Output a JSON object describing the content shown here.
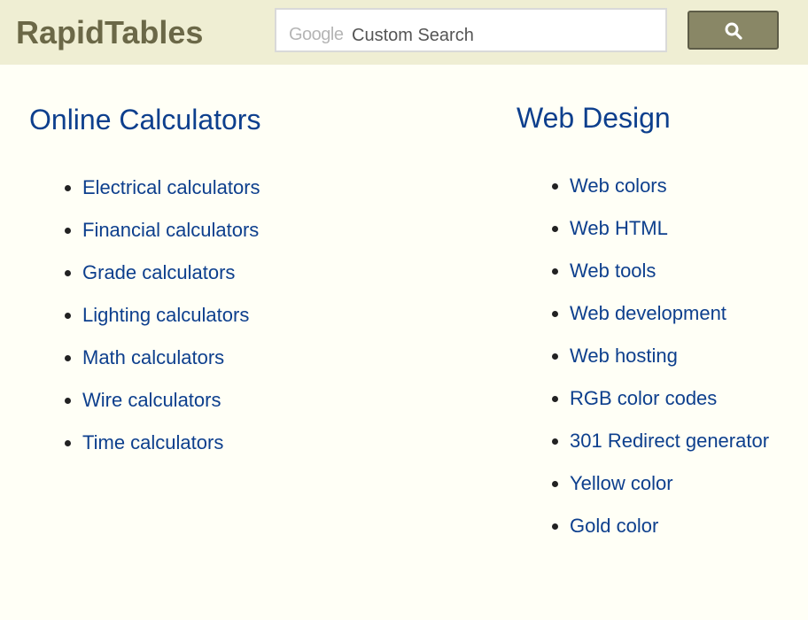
{
  "header": {
    "logo": "RapidTables",
    "search": {
      "brand": "Google",
      "placeholder": "Custom Search"
    },
    "search_button_icon": "search-icon"
  },
  "sections": [
    {
      "title": "Online Calculators",
      "items": [
        "Electrical calculators",
        "Financial calculators",
        "Grade calculators",
        "Lighting calculators",
        "Math calculators",
        "Wire calculators",
        "Time calculators"
      ]
    },
    {
      "title": "Web Design",
      "items": [
        "Web colors",
        "Web HTML",
        "Web tools",
        "Web development",
        "Web hosting",
        "RGB color codes",
        "301 Redirect generator",
        "Yellow color",
        "Gold color"
      ]
    }
  ],
  "colors": {
    "header_bg": "#efeed3",
    "logo": "#6b6847",
    "link": "#0d3f8d",
    "button": "#898766",
    "page_bg": "#fffff6"
  }
}
